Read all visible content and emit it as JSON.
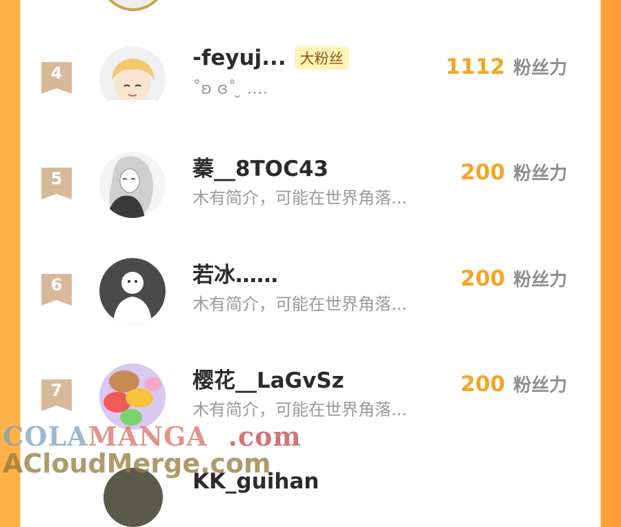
{
  "rows": [
    {
      "rank": "4",
      "name": "-feyuj...",
      "tag": "大粉丝",
      "bio": "˚ʚ ɞ˚ ̮ ....",
      "score": "1112",
      "unit": "粉丝力",
      "avatar_icon": "anime-boy-avatar-icon"
    },
    {
      "rank": "5",
      "name": "蓁__8TOC43",
      "tag": "",
      "bio": "木有简介，可能在世界角落...",
      "score": "200",
      "unit": "粉丝力",
      "avatar_icon": "sketch-girl-avatar-icon"
    },
    {
      "rank": "6",
      "name": "若冰……",
      "tag": "",
      "bio": "木有简介，可能在世界角落...",
      "score": "200",
      "unit": "粉丝力",
      "avatar_icon": "default-ghost-avatar-icon"
    },
    {
      "rank": "7",
      "name": "樱花__LaGvSz",
      "tag": "",
      "bio": "木有简介，可能在世界角落...",
      "score": "200",
      "unit": "粉丝力",
      "avatar_icon": "macaron-avatar-icon"
    }
  ],
  "partial_next": {
    "name": "KK_guihan"
  },
  "watermark": {
    "line1_a": "COLA",
    "line1_b": "MANGA",
    "line1_c": ".com",
    "line2": "ACloudMerge.com"
  },
  "colors": {
    "score": "#f2a623",
    "badge": "#d9b89a",
    "side_orange": "#ffa43a"
  }
}
